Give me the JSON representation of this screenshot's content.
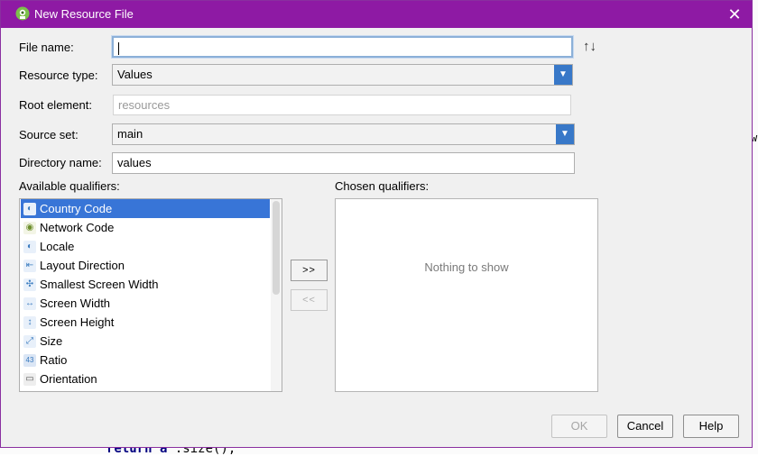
{
  "window": {
    "title": "New Resource File",
    "close_glyph": "✕"
  },
  "form": {
    "file_name": {
      "label": "File name:",
      "value": ""
    },
    "sort_icon": "↑↓",
    "resource_type": {
      "label": "Resource type:",
      "value": "Values"
    },
    "root_element": {
      "label": "Root element:",
      "placeholder": "resources"
    },
    "source_set": {
      "label": "Source set:",
      "value": "main"
    },
    "directory_name": {
      "label": "Directory name:",
      "value": "values"
    }
  },
  "available": {
    "label": "Available qualifiers:",
    "items": [
      {
        "label": "Country Code",
        "icon": "country-code-icon",
        "glyph": "◐",
        "color": "#3a7bbf"
      },
      {
        "label": "Network Code",
        "icon": "network-code-icon",
        "glyph": "◉",
        "color": "#6c8e2a"
      },
      {
        "label": "Locale",
        "icon": "locale-icon",
        "glyph": "◐",
        "color": "#3a7bbf"
      },
      {
        "label": "Layout Direction",
        "icon": "layout-direction-icon",
        "glyph": "⇤",
        "color": "#3a7bbf"
      },
      {
        "label": "Smallest Screen Width",
        "icon": "smallest-width-icon",
        "glyph": "✣",
        "color": "#3a7bbf"
      },
      {
        "label": "Screen Width",
        "icon": "screen-width-icon",
        "glyph": "↔",
        "color": "#3a7bbf"
      },
      {
        "label": "Screen Height",
        "icon": "screen-height-icon",
        "glyph": "↕",
        "color": "#3a7bbf"
      },
      {
        "label": "Size",
        "icon": "size-icon",
        "glyph": "⤢",
        "color": "#3a7bbf"
      },
      {
        "label": "Ratio",
        "icon": "ratio-icon",
        "glyph": "43",
        "color": "#3a7bbf"
      },
      {
        "label": "Orientation",
        "icon": "orientation-icon",
        "glyph": "▭",
        "color": "#555555"
      }
    ]
  },
  "move": {
    "add": ">>",
    "remove": "<<"
  },
  "chosen": {
    "label": "Chosen qualifiers:",
    "empty_text": "Nothing to show"
  },
  "buttons": {
    "ok": "OK",
    "cancel": "Cancel",
    "help": "Help"
  },
  "background_code": {
    "line": "return a",
    "suffix": ".size();",
    "side_char": "w"
  },
  "colors": {
    "titlebar": "#8e1aa4",
    "selection": "#3875d7",
    "combo_arrow": "#3878c8"
  }
}
